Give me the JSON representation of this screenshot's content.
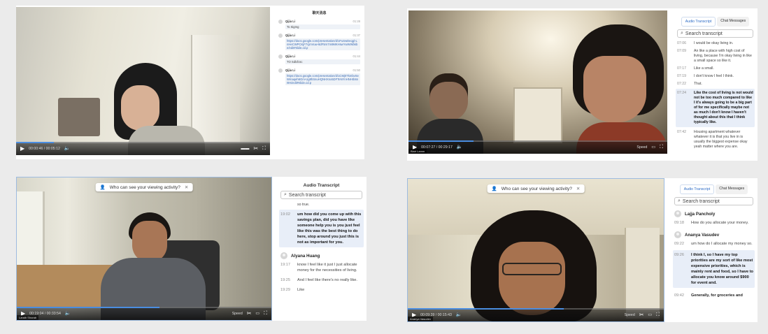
{
  "panels": [
    {
      "sidebar": {
        "title": "聊天消息",
        "messages": [
          {
            "sender": "Qijia Li",
            "time": "01:28",
            "text": "To Sigmg"
          },
          {
            "sender": "Qijia Li",
            "time": "01:37",
            "text": "https://docs.google.com/presentation/d/1FuSwDeqgl-LnHeCWPCKjF7cjmVuw-8dF5rn7m9MKHswYwWWbkbe/edit#slide=id.p"
          },
          {
            "sender": "Qijia Li",
            "time": "01:44",
            "text": "TO Sdlcfcsc"
          },
          {
            "sender": "Qijia Li",
            "time": "01:50",
            "text": "https://docs.google.com/presentation/d/1CMj0TkmbvSeWmaqeh6Gm-Ug8hSnuHQNHXnx5DFTeNYnHNHrb6nI9rs/edit#slide=id.p"
          }
        ]
      },
      "controls": {
        "time": "00:00:46 / 00:05:12"
      }
    },
    {
      "sidebar": {
        "tabs": [
          "Audio Transcript",
          "Chat Messages"
        ],
        "search_placeholder": "Search transcript",
        "lines": [
          {
            "time": "07:06",
            "text": "I would be okay living in."
          },
          {
            "time": "07:09",
            "text": "An like a place with high cost of living, because I'm okay living in like a small space so like it."
          },
          {
            "time": "07:17",
            "text": "Like a small."
          },
          {
            "time": "07:19",
            "text": "I don't know I feel I think."
          },
          {
            "time": "07:22",
            "text": "That."
          },
          {
            "time": "07:24",
            "text": "Like the cost of living is not would not be too much compared to like I it's always going to be a big part of for me specifically maybe not as much I don't know I haven't thought about this that I think typically like.",
            "highlight": true
          },
          {
            "time": "07:42",
            "text": "Housing apartment whatever whatever it is that you live in is usually the biggest expense okay yeah matter where you are."
          }
        ]
      },
      "controls": {
        "time": "00:07:27 / 00:29:17",
        "speed": "Speed"
      },
      "name_tag": "Blair Lamm"
    },
    {
      "tooltip": "Who can see your viewing activity?",
      "sidebar": {
        "title": "Audio Transcript",
        "search_placeholder": "Search transcript",
        "pre_text": "so true.",
        "highlight_time": "19:02",
        "highlight_text": "um how did you come up with this savings plan, did you have like someone help you is you just feel like this was the best thing to do here, stop around you just this is not as important for you.",
        "speaker": "Alyana Huang",
        "lines": [
          {
            "time": "19:17",
            "text": "know I feel like it just I just allocate money for the necessities of living."
          },
          {
            "time": "19:25",
            "text": "And I feel like there's no really like."
          },
          {
            "time": "19:29",
            "text": "Like"
          }
        ]
      },
      "controls": {
        "time": "00:19:04 / 00:33:54",
        "speed": "Speed"
      },
      "name_tag": "Laraib Shorab"
    },
    {
      "tooltip": "Who can see your viewing activity?",
      "sidebar": {
        "tabs": [
          "Audio Transcript",
          "Chat Messages"
        ],
        "search_placeholder": "Search transcript",
        "blocks": [
          {
            "speaker": "Lajja Pancholy",
            "time": "09:18",
            "text": "How do you allocate your money."
          },
          {
            "speaker": "Ananya Vasudev",
            "time": "09:22",
            "text": "um how do I allocate my money so."
          }
        ],
        "highlight_time": "09:26",
        "highlight_text": "I think I, so I have my top priorities are my sort of like most expensive priorities, which is mainly rent and food, so I have to allocate you know around $900 for event and.",
        "tail_time": "09:42",
        "tail_text": "Generally, for groceries and"
      },
      "controls": {
        "time": "00:09:39 / 00:15:43",
        "speed": "Speed"
      },
      "name_tag": "Ananya Vasudev"
    }
  ]
}
